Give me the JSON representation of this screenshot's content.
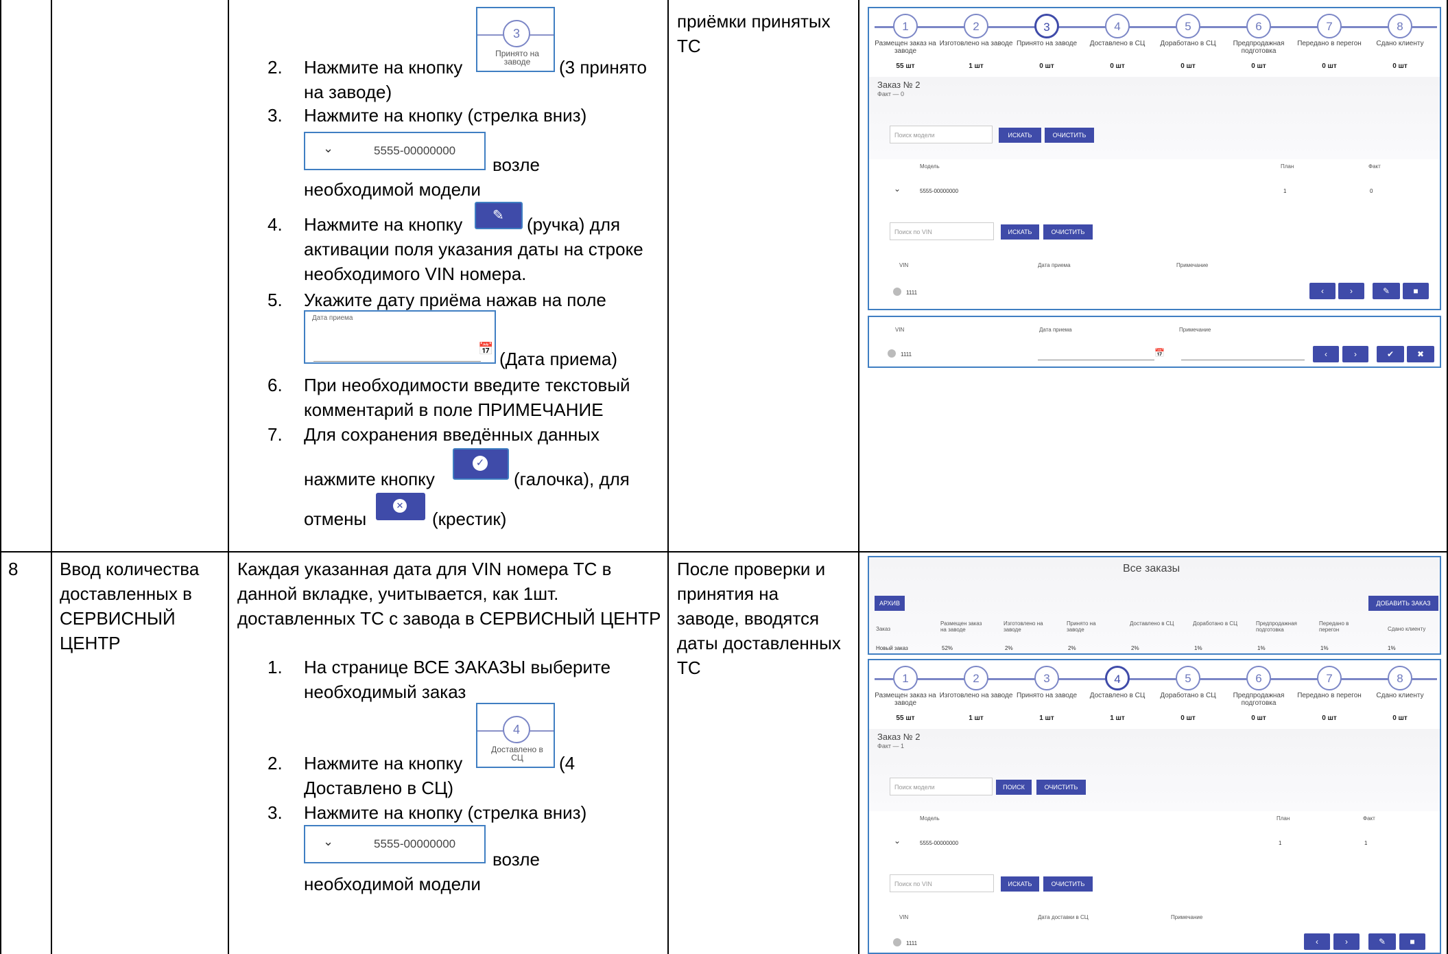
{
  "row7": {
    "steps": [
      {
        "num": "2.",
        "pre": "Нажмите на кнопку",
        "post": "(3 принято",
        "post2": "на заводе)"
      },
      {
        "num": "3.",
        "line1": "Нажмите на кнопку (стрелка вниз)",
        "after": "возле",
        "line3": "необходимой модели"
      },
      {
        "num": "4.",
        "pre": "Нажмите на кнопку",
        "post": "(ручка) для",
        "line2": "активации поля указания даты на строке",
        "line3": "необходимого VIN номера."
      },
      {
        "num": "5.",
        "line1": "Укажите дату приёма нажав на поле",
        "after": "(Дата приема)"
      },
      {
        "num": "6.",
        "line1": "При необходимости введите текстовый",
        "line2": "комментарий в поле ПРИМЕЧАНИЕ"
      },
      {
        "num": "7.",
        "line1": "Для сохранения введённых данных",
        "pre": "нажмите кнопку",
        "post": "(галочка), для",
        "pre2": "отмены",
        "post2": "(крестик)"
      }
    ],
    "inline_step_btn": {
      "num": "3",
      "label": "Принято на заводе"
    },
    "inline_model": "5555-00000000",
    "inline_date_label": "Дата приема",
    "note": [
      "приёмки принятых",
      "ТС"
    ]
  },
  "row8": {
    "num": "8",
    "title": [
      "Ввод количества",
      "доставленных в",
      "СЕРВИСНЫЙ",
      "ЦЕНТР"
    ],
    "desc": [
      "Каждая указанная дата для VIN номера ТС в",
      "данной вкладке, учитывается, как 1шт.",
      "доставленных ТС с завода в СЕРВИСНЫЙ ЦЕНТР"
    ],
    "steps": [
      {
        "num": "1.",
        "line1": "На странице ВСЕ ЗАКАЗЫ выберите",
        "line2": "необходимый заказ"
      },
      {
        "num": "2.",
        "pre": "Нажмите на кнопку",
        "post": "(4",
        "line2": "Доставлено в СЦ)"
      },
      {
        "num": "3.",
        "line1": "Нажмите на кнопку (стрелка вниз)",
        "after": "возле",
        "line3": "необходимой модели"
      }
    ],
    "inline_step_btn": {
      "num": "4",
      "label": "Доставлено в СЦ"
    },
    "inline_model": "5555-00000000",
    "note": [
      "После проверки и",
      "принятия на",
      "заводе, вводятся",
      "даты доставленных",
      "ТС"
    ]
  },
  "stepper_labels": [
    "Размещен заказ на заводе",
    "Изготовлено на заводе",
    "Принято на заводе",
    "Доставлено в СЦ",
    "Доработано в СЦ",
    "Предпродажная подготовка",
    "Передано в перегон",
    "Сдано клиенту"
  ],
  "ss1": {
    "counts": [
      "55 шт",
      "1 шт",
      "0 шт",
      "0 шт",
      "0 шт",
      "0 шт",
      "0 шт",
      "0 шт"
    ],
    "order": "Заказ № 2",
    "fact": "Факт — 0",
    "search_model_ph": "Поиск модели",
    "btn_search": "ИСКАТЬ",
    "btn_clear": "ОЧИСТИТЬ",
    "col_model": "Модель",
    "col_plan": "План",
    "col_fact": "Факт",
    "model": "5555-00000000",
    "plan": "1",
    "fact_val": "0",
    "search_vin_ph": "Поиск по VIN",
    "col_vin": "VIN",
    "col_date": "Дата приема",
    "col_note": "Примечание",
    "vin": "1111"
  },
  "ss2": {
    "col_vin": "VIN",
    "col_date": "Дата приема",
    "col_note": "Примечание",
    "vin": "1111"
  },
  "ss3": {
    "title": "Все заказы",
    "archive": "АРХИВ",
    "add": "ДОБАВИТЬ ЗАКАЗ",
    "col_order": "Заказ",
    "order_name": "Новый заказ",
    "percents": [
      "52%",
      "2%",
      "2%",
      "2%",
      "1%",
      "1%",
      "1%",
      "1%"
    ]
  },
  "ss4": {
    "counts": [
      "55 шт",
      "1 шт",
      "1 шт",
      "1 шт",
      "0 шт",
      "0 шт",
      "0 шт",
      "0 шт"
    ],
    "order": "Заказ № 2",
    "fact": "Факт — 1",
    "search_model_ph": "Поиск модели",
    "btn_search": "ПОИСК",
    "btn_search2": "ИСКАТЬ",
    "btn_clear": "ОЧИСТИТЬ",
    "col_model": "Модель",
    "col_plan": "План",
    "col_fact": "Факт",
    "model": "5555-00000000",
    "plan": "1",
    "fact_val": "1",
    "search_vin_ph": "Поиск по VIN",
    "col_vin": "VIN",
    "col_date": "Дата доставки в СЦ",
    "col_note": "Примечание",
    "vin": "1111"
  }
}
